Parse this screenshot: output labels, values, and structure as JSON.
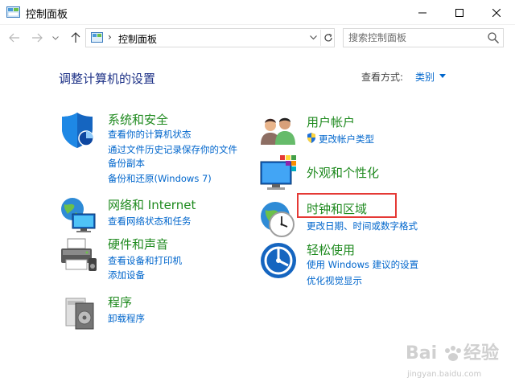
{
  "window": {
    "title": "控制面板"
  },
  "address_bar": {
    "separator": "›",
    "path": "控制面板"
  },
  "search": {
    "placeholder": "搜索控制面板"
  },
  "main": {
    "title": "调整计算机的设置",
    "view_by_label": "查看方式:",
    "view_by_value": "类别"
  },
  "categories": {
    "system_security": {
      "title": "系统和安全",
      "links": [
        "查看你的计算机状态",
        "通过文件历史记录保存你的文件",
        "备份副本",
        "备份和还原(Windows 7)"
      ]
    },
    "network": {
      "title": "网络和 Internet",
      "links": [
        "查看网络状态和任务"
      ]
    },
    "hardware": {
      "title": "硬件和声音",
      "links": [
        "查看设备和打印机",
        "添加设备"
      ]
    },
    "programs": {
      "title": "程序",
      "links": [
        "卸载程序"
      ]
    },
    "user_accounts": {
      "title": "用户帐户",
      "links": [
        "更改帐户类型"
      ]
    },
    "appearance": {
      "title": "外观和个性化"
    },
    "clock_region": {
      "title": "时钟和区域",
      "links": [
        "更改日期、时间或数字格式"
      ]
    },
    "ease_of_access": {
      "title": "轻松使用",
      "links": [
        "使用 Windows 建议的设置",
        "优化视觉显示"
      ]
    }
  },
  "watermark": {
    "brand": "Bai",
    "brand2": "经验",
    "url": "jingyan.baidu.com"
  },
  "colors": {
    "category_title": "#1f8a1f",
    "link": "#0066cc",
    "heading": "#1e3287",
    "highlight": "#e53935"
  }
}
